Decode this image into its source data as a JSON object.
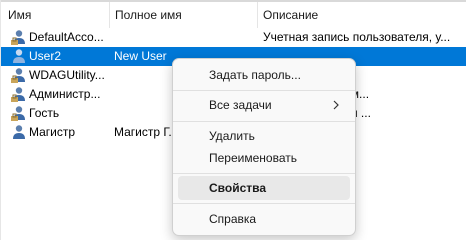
{
  "columns": [
    "Имя",
    "Полное имя",
    "Описание"
  ],
  "rows": [
    {
      "name": "DefaultAcco...",
      "fullname": "",
      "description": "Учетная запись пользователя, у..."
    },
    {
      "name": "User2",
      "fullname": "New User",
      "description": ""
    },
    {
      "name": "WDAGUtility...",
      "fullname": "",
      "description": "...тель, упра..."
    },
    {
      "name": "Администр...",
      "fullname": "",
      "description": "...ная запись адм..."
    },
    {
      "name": "Гость",
      "fullname": "",
      "description": "...ная запись для ..."
    },
    {
      "name": "Магистр",
      "fullname": "Магистр Г...",
      "description": "...2-го МД"
    }
  ],
  "selected_row": "User2",
  "menu": {
    "set_password": "Задать пароль...",
    "all_tasks": "Все задачи",
    "delete": "Удалить",
    "rename": "Переименовать",
    "properties": "Свойства",
    "help": "Справка"
  },
  "colors": {
    "selection": "#0078d7",
    "menu_bg": "#f9f9f9",
    "menu_hover": "#e8e8e8"
  },
  "icons": {
    "user": "user-icon",
    "submenu": "chevron-right-icon"
  }
}
